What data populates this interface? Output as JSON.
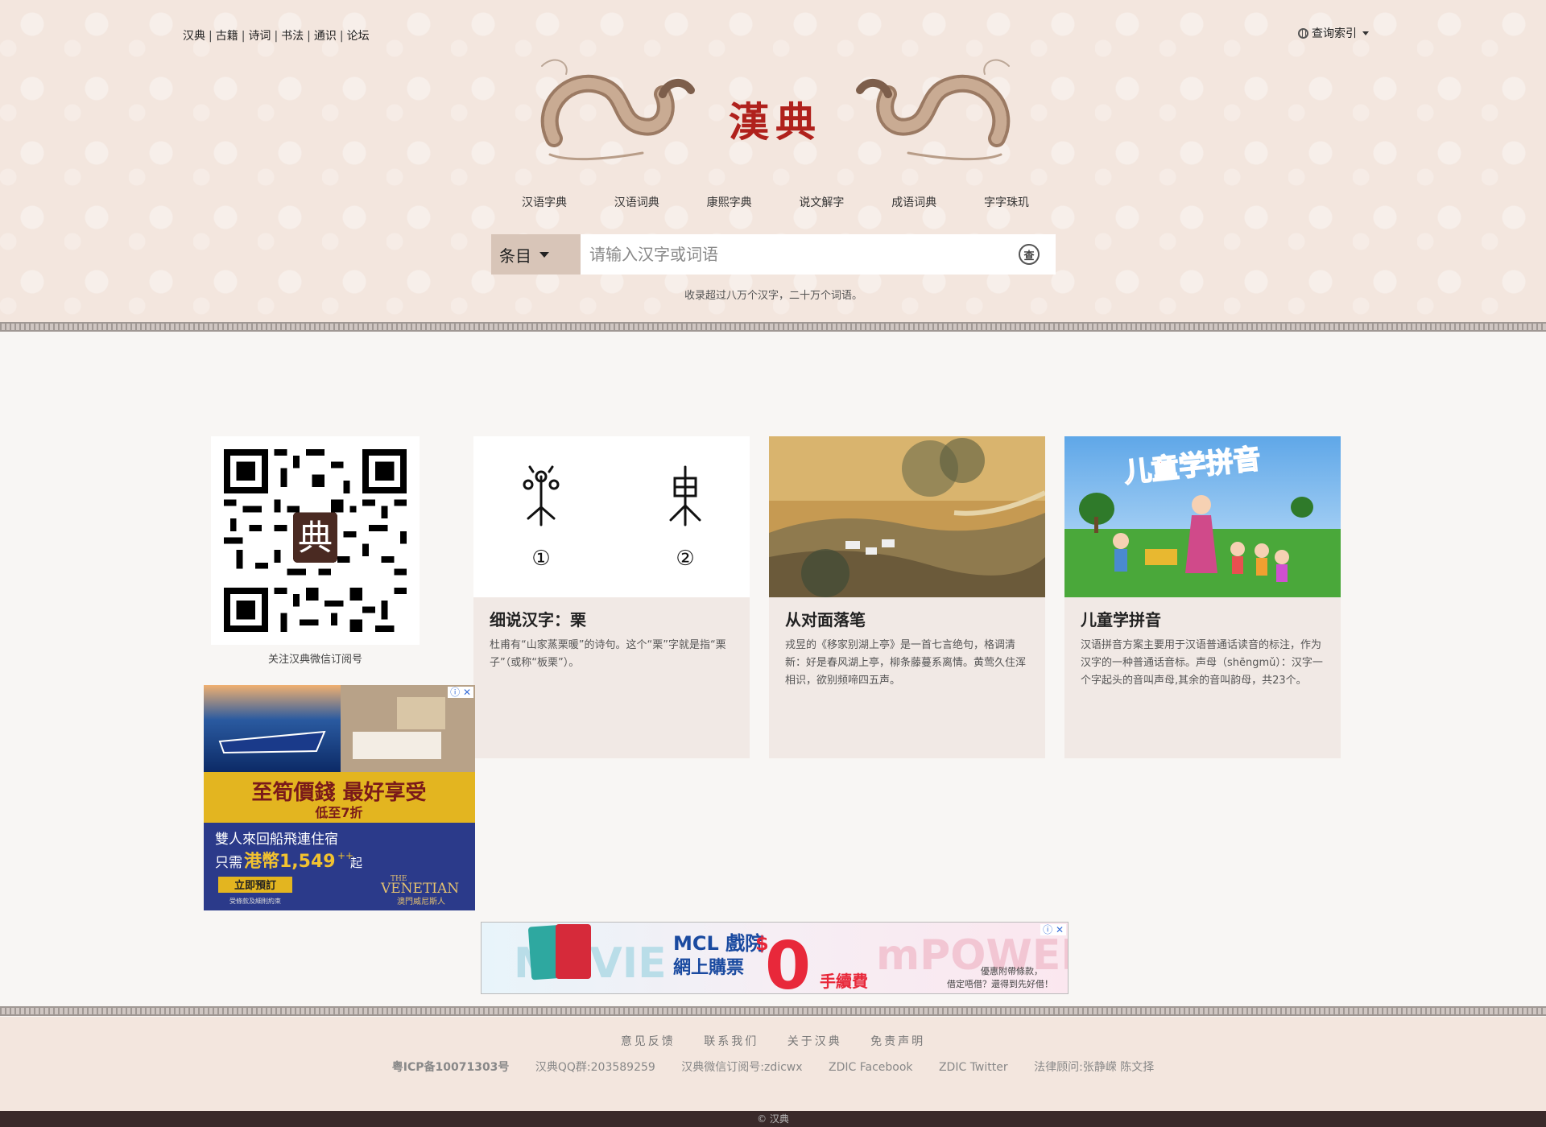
{
  "toplinks": [
    "汉典",
    "古籍",
    "诗词",
    "书法",
    "通识",
    "论坛"
  ],
  "query_index": "查询索引",
  "logo_title": "漢典",
  "mainnav": [
    "汉语字典",
    "汉语词典",
    "康熙字典",
    "说文解字",
    "成语词典",
    "字字珠玑"
  ],
  "search": {
    "category": "条目",
    "placeholder": "请输入汉字或词语",
    "button": "查",
    "note": "收录超过八万个汉字，二十万个词语。"
  },
  "qr": {
    "center_glyph": "典",
    "caption": "关注汉典微信订阅号"
  },
  "cards": [
    {
      "title": "细说汉字：栗",
      "text": "杜甫有“山家蒸栗暖”的诗句。这个“栗”字就是指“栗子”（或称“板栗”）。",
      "marks": [
        "①",
        "②"
      ]
    },
    {
      "title": "从对面落笔",
      "text": "戎昱的《移家别湖上亭》是一首七言绝句，格调清新：好是春风湖上亭，柳条藤蔓系离情。黄莺久住浑相识，欲别频啼四五声。"
    },
    {
      "title": "儿童学拼音",
      "text": "汉语拼音方案主要用于汉语普通话读音的标注，作为汉字的一种普通话音标。声母（shēngmǔ）：汉字一个字起头的音叫声母,其余的音叫韵母，共23个。",
      "banner": "儿童学拼音"
    }
  ],
  "ad_left": {
    "headline": "至筍價錢 最好享受",
    "sub": "低至7折",
    "line1": "雙人來回船飛連住宿",
    "line2_prefix": "只需",
    "price": "港幣1,549",
    "plus": "++",
    "line2_suffix": "起",
    "button": "立即預訂",
    "fineprint": "受條款及細則約束",
    "brand_the": "THE",
    "brand": "VENETIAN",
    "brand_cn": "澳門威尼斯人"
  },
  "ad_bottom": {
    "brand": "MCL 戲院",
    "line2": "網上購票",
    "currency": "$",
    "amount": "0",
    "fee": "手續費",
    "bg_left": "MOVIE",
    "bg_right": "mPOWER",
    "note1": "優惠附帶條款，",
    "note2": "借定唔借？還得到先好借！"
  },
  "ad_close": "ⓘ ✕",
  "footer": {
    "links": [
      "意见反馈",
      "联系我们",
      "关于汉典",
      "免责声明"
    ],
    "icp": "粤ICP备10071303号",
    "info": [
      "汉典QQ群:203589259",
      "汉典微信订阅号:zdicwx",
      "ZDIC Facebook",
      "ZDIC Twitter",
      "法律顾问:张静嵘 陈文择"
    ],
    "copyright": "© 汉典"
  },
  "colors": {
    "header_bg": "#f3e6de",
    "logo_red": "#b0211c",
    "card_bg": "#f1e9e5",
    "search_cat_bg": "#d8c5b8"
  }
}
